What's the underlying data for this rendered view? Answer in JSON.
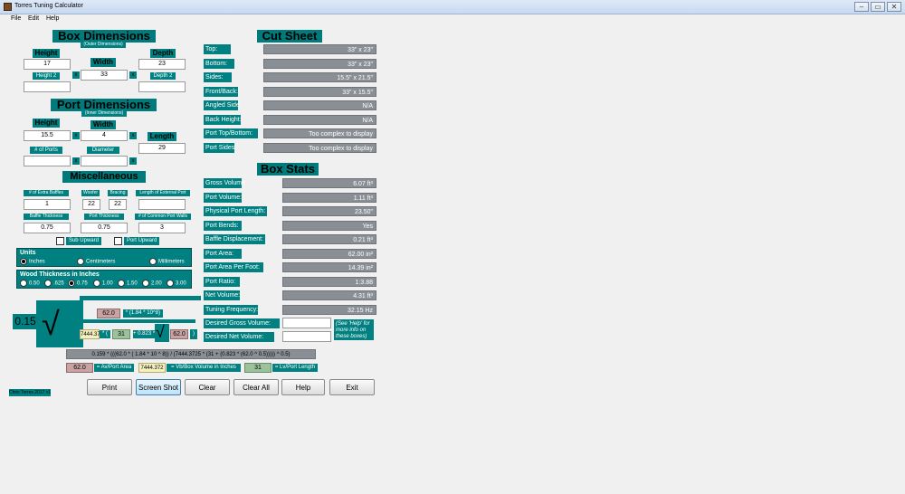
{
  "window": {
    "title": "Torres Tuning Calculator",
    "min": "–",
    "max": "▭",
    "close": "✕"
  },
  "menu": [
    "File",
    "Edit",
    "Help"
  ],
  "box_dimensions": {
    "title": "Box Dimensions",
    "subtitle": "(Outer Dimensions)",
    "height_label": "Height",
    "width_label": "Width",
    "depth_label": "Depth",
    "height": "17",
    "width": "33",
    "depth": "23",
    "height2_label": "Height 2",
    "depth2_label": "Depth 2",
    "height2": "",
    "depth2": "",
    "x": "x"
  },
  "port_dimensions": {
    "title": "Port Dimensions",
    "subtitle": "(Inner Dimensions)",
    "height_label": "Height",
    "width_label": "Width",
    "length_label": "Length",
    "height": "15.5",
    "width": "4",
    "length": "29",
    "num_ports_label": "# of Ports",
    "diameter_label": "Diameter",
    "num_ports": "",
    "diameter": ""
  },
  "misc": {
    "title": "Miscellaneous",
    "extra_baffles_label": "# of Extra Baffles",
    "extra_baffles": "1",
    "woofer_label": "Woofer",
    "woofer": "22",
    "bracing_label": "Bracing",
    "bracing": "22",
    "ext_port_label": "Length of External Port",
    "ext_port": "",
    "baffle_thick_label": "Baffle Thickness",
    "baffle_thick": "0.75",
    "port_thick_label": "Port Thickness",
    "port_thick": "0.75",
    "common_walls_label": "# of Common Port Walls",
    "common_walls": "3",
    "sub_upward": "Sub Upward",
    "port_upward": "Port Upward"
  },
  "units": {
    "title": "Units",
    "options": [
      "Inches",
      "Centimeters",
      "Millimeters"
    ],
    "selected": "Inches"
  },
  "wood": {
    "title": "Wood Thickness in Inches",
    "options": [
      "0.50",
      ".625",
      "0.75",
      "1.00",
      "1.50",
      "2.00",
      "3.00"
    ],
    "selected": "0.75"
  },
  "formula": {
    "coef": "0.15",
    "v1": "62.0",
    "t1": "* (1.84 * 10^8)",
    "v2": "7444.372",
    "v3": "31",
    "t3": "+ 0.823 *",
    "v4": "62.0",
    "full": "0.159 * (((62.0 * ( 1.84 * 10 ^ 8)) / (7444.3725 * (31 + (0.823 * (62.0 ^ 0.5))))) ^ 0.5)",
    "legend": [
      {
        "value": "62.0",
        "text": "= Av/Port Area"
      },
      {
        "value": "7444.372",
        "text": "= Vb/Box Volume in Inches"
      },
      {
        "value": "31",
        "text": "= Lv/Port Length"
      }
    ]
  },
  "cut_sheet": {
    "title": "Cut Sheet",
    "rows": [
      {
        "label": "Top:",
        "value": "33\" x 23\""
      },
      {
        "label": "Bottom:",
        "value": "33\" x 23\""
      },
      {
        "label": "Sides:",
        "value": "15.5\" x 21.5\""
      },
      {
        "label": "Front/Back:",
        "value": "33\" x 15.5\""
      },
      {
        "label": "Angled Side:",
        "value": "N/A"
      },
      {
        "label": "Back Height:",
        "value": "N/A"
      },
      {
        "label": "Port Top/Bottom:",
        "value": "Too complex to display"
      },
      {
        "label": "Port Sides:",
        "value": "Too complex to display"
      }
    ]
  },
  "box_stats": {
    "title": "Box Stats",
    "rows": [
      {
        "label": "Gross Volume:",
        "value": "6.07 ft³"
      },
      {
        "label": "Port Volume:",
        "value": "1.11 ft³"
      },
      {
        "label": "Physical Port Length:",
        "value": "23.50\""
      },
      {
        "label": "Port Bends:",
        "value": "Yes"
      },
      {
        "label": "Baffle Displacement:",
        "value": "0.21 ft³"
      },
      {
        "label": "Port Area:",
        "value": "62.00 in²"
      },
      {
        "label": "Port Area Per Foot:",
        "value": "14.39 in²"
      },
      {
        "label": "Port Ratio:",
        "value": "1:3.88"
      },
      {
        "label": "Net Volume:",
        "value": "4.31 ft³"
      },
      {
        "label": "Tuning Frequency:",
        "value": "32.15 Hz"
      }
    ],
    "desired_gross_label": "Desired Gross Volume:",
    "desired_net_label": "Desired Net Volume:",
    "desired_gross": "",
    "desired_net": "",
    "help_note": "(See 'Help' for more info on these boxes)"
  },
  "buttons": {
    "print": "Print",
    "screenshot": "Screen Shot",
    "clear": "Clear",
    "clear_all": "Clear All",
    "help": "Help",
    "exit": "Exit"
  },
  "footer": "Chris Torres 2017 v1.1"
}
